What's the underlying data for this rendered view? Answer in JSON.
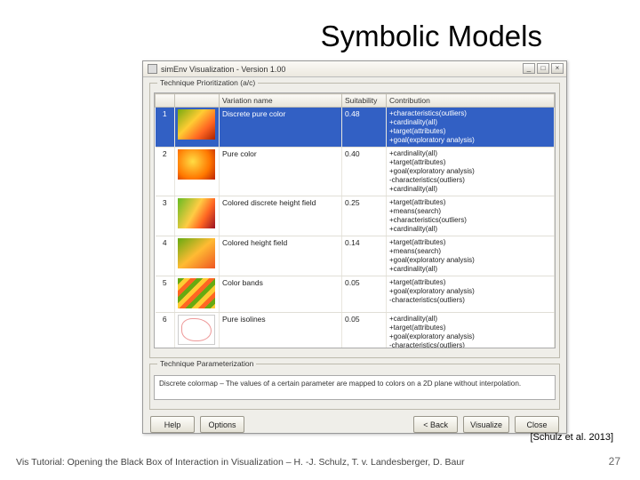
{
  "slide": {
    "title": "Symbolic Models",
    "citation": "[Schulz et al. 2013]",
    "footer": "Vis Tutorial: Opening the Black Box of Interaction in Visualization – H. -J. Schulz, T. v. Landesberger, D. Baur",
    "page": "27"
  },
  "window": {
    "title": "simEnv Visualization - Version 1.00",
    "group1_title": "Technique Prioritization (a/c)",
    "group2_title": "Technique Parameterization",
    "columns": {
      "c0": "",
      "c1": "",
      "c2": "Variation name",
      "c3": "Suitability",
      "c4": "Contribution"
    },
    "buttons": {
      "help": "Help",
      "options": "Options",
      "back": "< Back",
      "visualize": "Visualize",
      "close": "Close"
    },
    "desc": "Discrete colormap – The values of a certain parameter are mapped to colors on a 2D plane without interpolation.",
    "rows": [
      {
        "n": "1",
        "name": "Discrete pure color",
        "suit": "0.48",
        "contrib": [
          "+characteristics(outliers)",
          "+cardinality(all)",
          "+target(attributes)",
          "+goal(exploratory analysis)"
        ]
      },
      {
        "n": "2",
        "name": "Pure color",
        "suit": "0.40",
        "contrib": [
          "+cardinality(all)",
          "+target(attributes)",
          "+goal(exploratory analysis)",
          "-characteristics(outliers)",
          "+cardinality(all)"
        ]
      },
      {
        "n": "3",
        "name": "Colored discrete height field",
        "suit": "0.25",
        "contrib": [
          "+target(attributes)",
          "+means(search)",
          "+characteristics(outliers)",
          "+cardinality(all)"
        ]
      },
      {
        "n": "4",
        "name": "Colored height field",
        "suit": "0.14",
        "contrib": [
          "+target(attributes)",
          "+means(search)",
          "+goal(exploratory analysis)",
          "+cardinality(all)"
        ]
      },
      {
        "n": "5",
        "name": "Color bands",
        "suit": "0.05",
        "contrib": [
          "+target(attributes)",
          "+goal(exploratory analysis)",
          "-characteristics(outliers)"
        ]
      },
      {
        "n": "6",
        "name": "Pure isolines",
        "suit": "0.05",
        "contrib": [
          "+cardinality(all)",
          "+target(attributes)",
          "+goal(exploratory analysis)",
          "-characteristics(outliers)"
        ]
      }
    ]
  }
}
